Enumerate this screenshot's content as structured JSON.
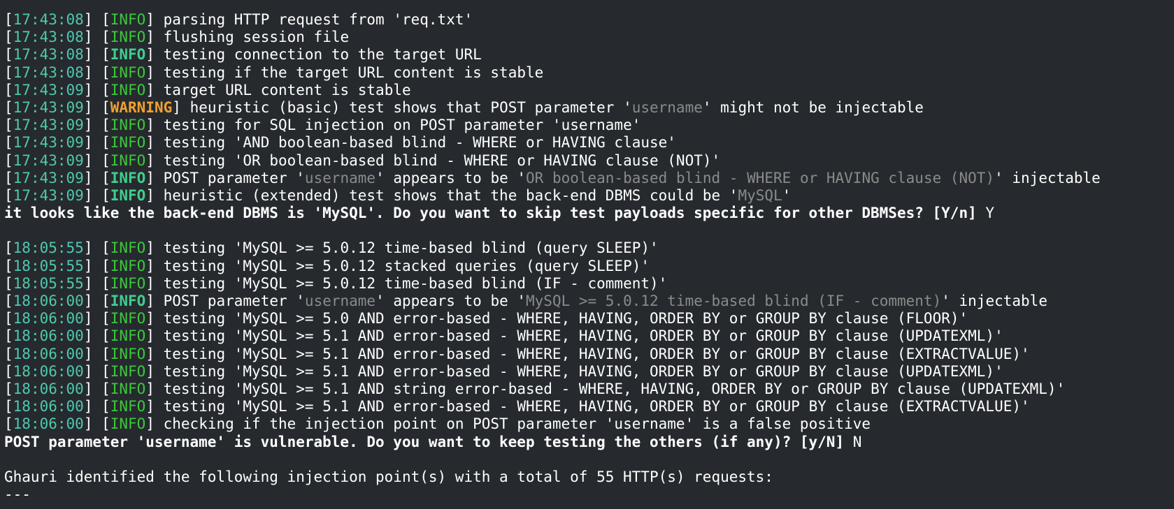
{
  "terminal": {
    "lines": [
      {
        "type": "log",
        "time": "17:43:08",
        "level": "INFO",
        "level_bold": false,
        "segments": [
          {
            "t": "parsing HTTP request from 'req.txt'"
          }
        ]
      },
      {
        "type": "log",
        "time": "17:43:08",
        "level": "INFO",
        "level_bold": false,
        "segments": [
          {
            "t": "flushing session file"
          }
        ]
      },
      {
        "type": "log",
        "time": "17:43:08",
        "level": "INFO",
        "level_bold": true,
        "segments": [
          {
            "t": "testing connection to the target URL"
          }
        ]
      },
      {
        "type": "log",
        "time": "17:43:08",
        "level": "INFO",
        "level_bold": false,
        "segments": [
          {
            "t": "testing if the target URL content is stable"
          }
        ]
      },
      {
        "type": "log",
        "time": "17:43:09",
        "level": "INFO",
        "level_bold": false,
        "segments": [
          {
            "t": "target URL content is stable"
          }
        ]
      },
      {
        "type": "log",
        "time": "17:43:09",
        "level": "WARNING",
        "level_bold": true,
        "segments": [
          {
            "t": "heuristic (basic) test shows that POST parameter '"
          },
          {
            "t": "username",
            "dim": true
          },
          {
            "t": "' might not be injectable"
          }
        ]
      },
      {
        "type": "log",
        "time": "17:43:09",
        "level": "INFO",
        "level_bold": false,
        "segments": [
          {
            "t": "testing for SQL injection on POST parameter 'username'"
          }
        ]
      },
      {
        "type": "log",
        "time": "17:43:09",
        "level": "INFO",
        "level_bold": false,
        "segments": [
          {
            "t": "testing 'AND boolean-based blind - WHERE or HAVING clause'"
          }
        ]
      },
      {
        "type": "log",
        "time": "17:43:09",
        "level": "INFO",
        "level_bold": false,
        "segments": [
          {
            "t": "testing 'OR boolean-based blind - WHERE or HAVING clause (NOT)'"
          }
        ]
      },
      {
        "type": "log",
        "time": "17:43:09",
        "level": "INFO",
        "level_bold": true,
        "segments": [
          {
            "t": "POST parameter '"
          },
          {
            "t": "username",
            "dim": true
          },
          {
            "t": "' appears to be '"
          },
          {
            "t": "OR boolean-based blind - WHERE or HAVING clause (NOT)",
            "dim": true
          },
          {
            "t": "' injectable"
          }
        ]
      },
      {
        "type": "log",
        "time": "17:43:09",
        "level": "INFO",
        "level_bold": true,
        "segments": [
          {
            "t": "heuristic (extended) test shows that the back-end DBMS could be '"
          },
          {
            "t": "MySQL",
            "dim": true
          },
          {
            "t": "'"
          }
        ]
      },
      {
        "type": "prompt",
        "text": "it looks like the back-end DBMS is 'MySQL'. Do you want to skip test payloads specific for other DBMSes? [Y/n]",
        "answer": " Y"
      },
      {
        "type": "blank"
      },
      {
        "type": "log",
        "time": "18:05:55",
        "level": "INFO",
        "level_bold": false,
        "segments": [
          {
            "t": "testing 'MySQL >= 5.0.12 time-based blind (query SLEEP)'"
          }
        ]
      },
      {
        "type": "log",
        "time": "18:05:55",
        "level": "INFO",
        "level_bold": false,
        "segments": [
          {
            "t": "testing 'MySQL >= 5.0.12 stacked queries (query SLEEP)'"
          }
        ]
      },
      {
        "type": "log",
        "time": "18:05:55",
        "level": "INFO",
        "level_bold": false,
        "segments": [
          {
            "t": "testing 'MySQL >= 5.0.12 time-based blind (IF - comment)'"
          }
        ]
      },
      {
        "type": "log",
        "time": "18:06:00",
        "level": "INFO",
        "level_bold": true,
        "segments": [
          {
            "t": "POST parameter '"
          },
          {
            "t": "username",
            "dim": true
          },
          {
            "t": "' appears to be '"
          },
          {
            "t": "MySQL >= 5.0.12 time-based blind (IF - comment)",
            "dim": true
          },
          {
            "t": "' injectable"
          }
        ]
      },
      {
        "type": "log",
        "time": "18:06:00",
        "level": "INFO",
        "level_bold": false,
        "segments": [
          {
            "t": "testing 'MySQL >= 5.0 AND error-based - WHERE, HAVING, ORDER BY or GROUP BY clause (FLOOR)'"
          }
        ]
      },
      {
        "type": "log",
        "time": "18:06:00",
        "level": "INFO",
        "level_bold": false,
        "segments": [
          {
            "t": "testing 'MySQL >= 5.1 AND error-based - WHERE, HAVING, ORDER BY or GROUP BY clause (UPDATEXML)'"
          }
        ]
      },
      {
        "type": "log",
        "time": "18:06:00",
        "level": "INFO",
        "level_bold": false,
        "segments": [
          {
            "t": "testing 'MySQL >= 5.1 AND error-based - WHERE, HAVING, ORDER BY or GROUP BY clause (EXTRACTVALUE)'"
          }
        ]
      },
      {
        "type": "log",
        "time": "18:06:00",
        "level": "INFO",
        "level_bold": false,
        "segments": [
          {
            "t": "testing 'MySQL >= 5.1 AND error-based - WHERE, HAVING, ORDER BY or GROUP BY clause (UPDATEXML)'"
          }
        ]
      },
      {
        "type": "log",
        "time": "18:06:00",
        "level": "INFO",
        "level_bold": false,
        "segments": [
          {
            "t": "testing 'MySQL >= 5.1 AND string error-based - WHERE, HAVING, ORDER BY or GROUP BY clause (UPDATEXML)'"
          }
        ]
      },
      {
        "type": "log",
        "time": "18:06:00",
        "level": "INFO",
        "level_bold": false,
        "segments": [
          {
            "t": "testing 'MySQL >= 5.1 AND error-based - WHERE, HAVING, ORDER BY or GROUP BY clause (EXTRACTVALUE)'"
          }
        ]
      },
      {
        "type": "log",
        "time": "18:06:00",
        "level": "INFO",
        "level_bold": false,
        "segments": [
          {
            "t": "checking if the injection point on POST parameter 'username' is a false positive"
          }
        ]
      },
      {
        "type": "prompt",
        "text": "POST parameter 'username' is vulnerable. Do you want to keep testing the others (if any)? [y/N]",
        "answer": " N"
      },
      {
        "type": "blank"
      },
      {
        "type": "plain",
        "text": "Ghauri identified the following injection point(s) with a total of 55 HTTP(s) requests:"
      },
      {
        "type": "plain",
        "text": "---"
      }
    ]
  },
  "colors": {
    "background": "#262a2e",
    "timestamp": "#4ec9b0",
    "info": "#3cc83c",
    "warning": "#f0a030",
    "dim": "#8a8a8a"
  }
}
